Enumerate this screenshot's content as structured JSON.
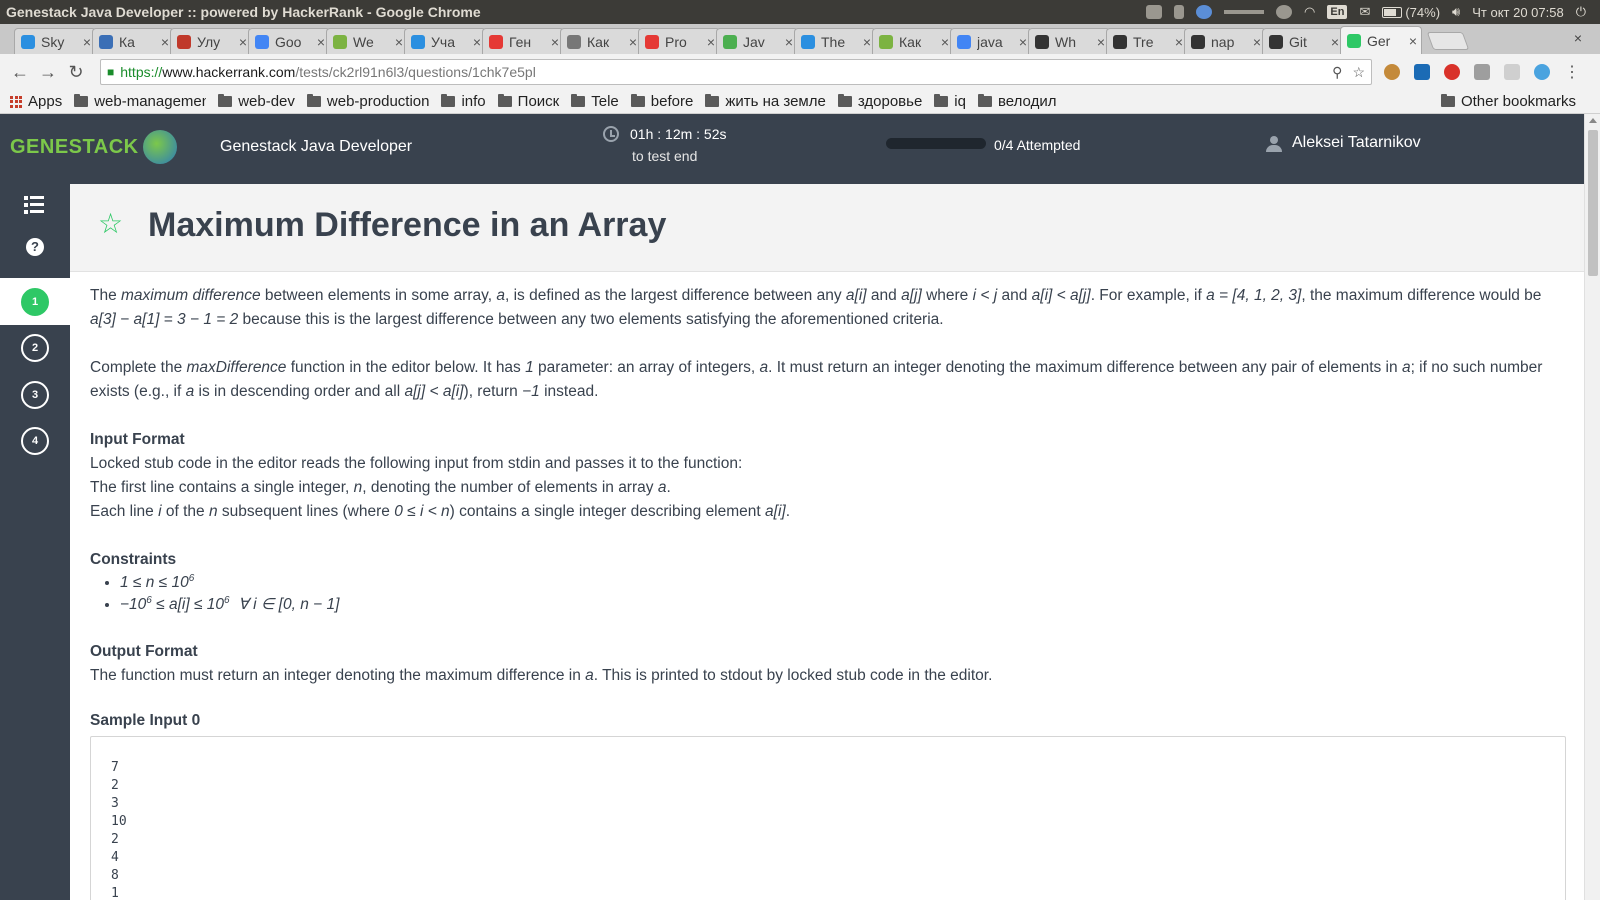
{
  "os": {
    "window_title": "Genestack Java Developer :: powered by HackerRank - Google Chrome",
    "battery": "(74%)",
    "lang": "En",
    "clock": "Чт окт 20 07:58"
  },
  "tabs": [
    {
      "title": "Sky",
      "icon_color": "#2b8fe0"
    },
    {
      "title": "Ка",
      "icon_color": "#3b6fb6"
    },
    {
      "title": "Улу",
      "icon_color": "#c0392b"
    },
    {
      "title": "Goo",
      "icon_color": "#4285f4"
    },
    {
      "title": "We",
      "icon_color": "#7cb342"
    },
    {
      "title": "Уча",
      "icon_color": "#2b8fe0"
    },
    {
      "title": "Ген",
      "icon_color": "#e53935"
    },
    {
      "title": "Как",
      "icon_color": "#777777"
    },
    {
      "title": "Pro",
      "icon_color": "#e53935"
    },
    {
      "title": "Jav",
      "icon_color": "#4caf50"
    },
    {
      "title": "The",
      "icon_color": "#2b8fe0"
    },
    {
      "title": "Как",
      "icon_color": "#7cb342"
    },
    {
      "title": "java",
      "icon_color": "#4285f4"
    },
    {
      "title": "Wh",
      "icon_color": "#333333"
    },
    {
      "title": "Tre",
      "icon_color": "#333333"
    },
    {
      "title": "nap",
      "icon_color": "#333333"
    },
    {
      "title": "Git",
      "icon_color": "#333333"
    },
    {
      "title": "Ger",
      "icon_color": "#2ec866",
      "active": true
    }
  ],
  "address": {
    "scheme": "https://",
    "host": "www.hackerrank.com",
    "path": "/tests/ck2rl91n6l3/questions/1chk7e5pl"
  },
  "bookmarks": {
    "apps": "Apps",
    "items": [
      "web-managemen",
      "web-dev",
      "web-production",
      "info",
      "Поиск",
      "Tele",
      "before",
      "жить на земле",
      "здоровье",
      "iq",
      "велодил"
    ],
    "other": "Other bookmarks"
  },
  "header": {
    "logo": "GENESTACK",
    "test_name": "Genestack Java Developer",
    "timer": "01h : 12m : 52s",
    "timer_caption": "to test end",
    "progress": 0.0,
    "progress_text": "0/4 Attempted",
    "user": "Aleksei Tatarnikov"
  },
  "sidebar": {
    "questions": [
      "1",
      "2",
      "3",
      "4"
    ],
    "active": 0
  },
  "problem": {
    "title": "Maximum Difference in an Array",
    "p1_a": "The ",
    "p1_em1": "maximum difference",
    "p1_b": " between elements in some array, ",
    "p1_em2": "a",
    "p1_c": ", is defined as the largest difference between any ",
    "p1_em3": "a[i]",
    "p1_d": " and ",
    "p1_em4": "a[j]",
    "p1_e": " where ",
    "p1_em5": "i < j",
    "p1_f": " and ",
    "p1_em6": "a[i] < a[j]",
    "p1_g": ". For example, if ",
    "p1_em7": "a = [4, 1, 2, 3]",
    "p1_h": ", the maximum difference would be ",
    "p1_em8": "a[3] − a[1] = 3 − 1 = 2",
    "p1_i": " because this is the largest difference between any two elements satisfying the aforementioned criteria.",
    "p2_a": "Complete the ",
    "p2_em1": "maxDifference",
    "p2_b": " function in the editor below. It has ",
    "p2_em2": "1",
    "p2_c": " parameter: an array of integers, ",
    "p2_em3": "a",
    "p2_d": ". It must return an integer denoting the maximum difference between any pair of elements in ",
    "p2_em4": "a",
    "p2_e": "; if no such number exists (e.g., if ",
    "p2_em5": "a",
    "p2_f": " is in descending order and all ",
    "p2_em6": "a[j] < a[i]",
    "p2_g": "), return ",
    "p2_em7": "−1",
    "p2_h": " instead.",
    "input_h": "Input Format",
    "input_1": "Locked stub code in the editor reads the following input from stdin and passes it to the function:",
    "input_2a": "The first line contains a single integer, ",
    "input_2em1": "n",
    "input_2b": ", denoting the number of elements in array ",
    "input_2em2": "a",
    "input_2c": ".",
    "input_3a": "Each line ",
    "input_3em1": "i",
    "input_3b": " of the ",
    "input_3em2": "n",
    "input_3c": " subsequent lines (where ",
    "input_3em3": "0 ≤ i < n",
    "input_3d": ") contains a single integer describing element ",
    "input_3em4": "a[i]",
    "input_3e": ".",
    "constraints_h": "Constraints",
    "c1_a": "1 ≤ n ≤ 10",
    "c1_sup": "6",
    "c2_a": "−10",
    "c2_sup1": "6",
    "c2_b": " ≤ a[i] ≤ 10",
    "c2_sup2": "6",
    "c2_c": "  ∀ i ∈ [0, n − 1]",
    "output_h": "Output Format",
    "output_a": "The function must return an integer denoting the maximum difference in ",
    "output_em": "a",
    "output_b": ". This is printed to stdout by locked stub code in the editor.",
    "sample_h": "Sample Input 0",
    "sample_input": "7\n2\n3\n10\n2\n4\n8\n1"
  }
}
